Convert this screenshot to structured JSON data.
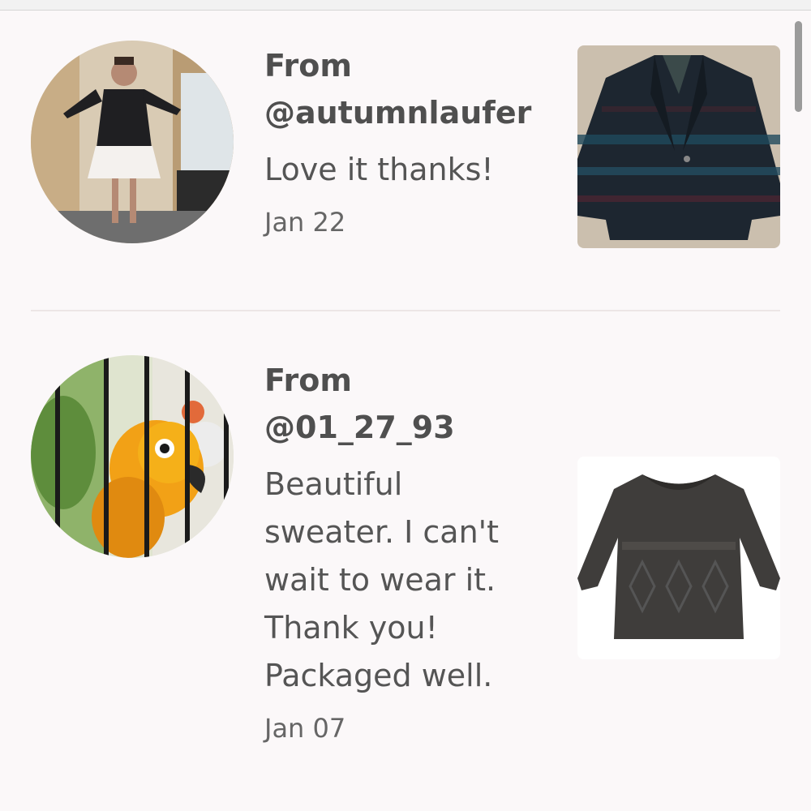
{
  "reviews": [
    {
      "from_label": "From",
      "username": "@autumnlaufer",
      "comment": "Love it thanks!",
      "date": "Jan 22"
    },
    {
      "from_label": "From",
      "username": "@01_27_93",
      "comment": "Beautiful sweater. I can't wait to wear it. Thank you! Packaged well.",
      "date": "Jan 07"
    }
  ],
  "colors": {
    "background": "#fbf8f9",
    "username_text": "#4f4f4f",
    "body_text": "#555555",
    "divider": "#ece6e6"
  }
}
